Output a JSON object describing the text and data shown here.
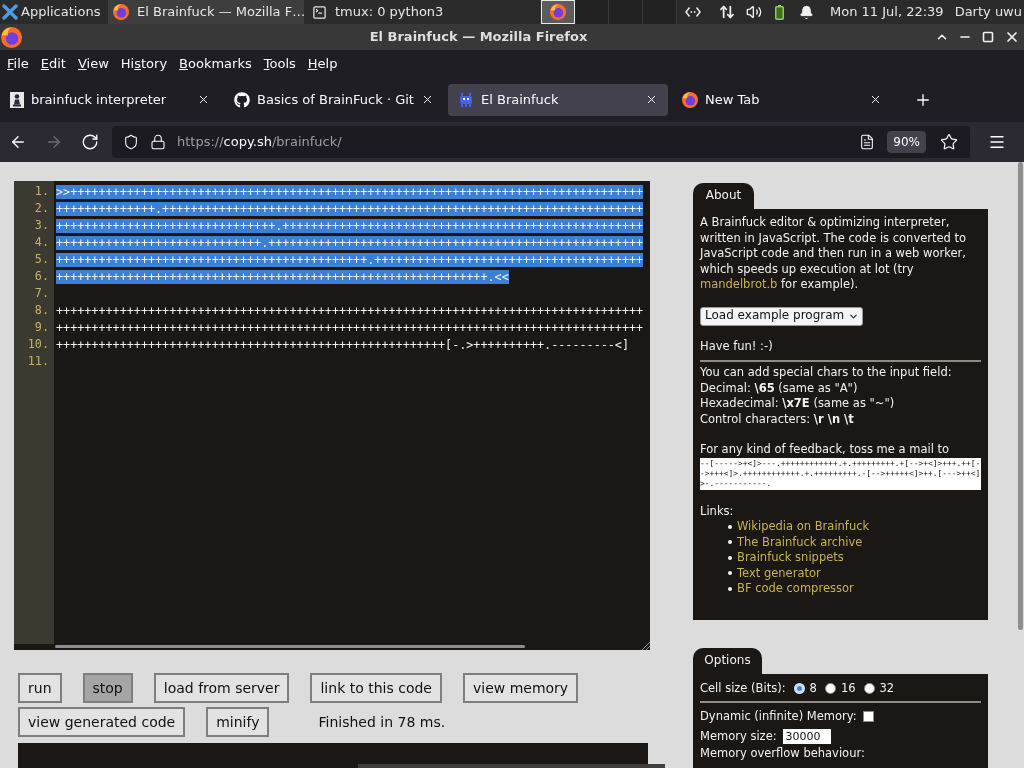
{
  "taskbar": {
    "apps_menu": "Applications",
    "windows": [
      {
        "kind": "browser",
        "title": "El Brainfuck — Mozilla F…",
        "selected": true
      },
      {
        "kind": "terminal",
        "title": "tmux: 0 python3",
        "selected": false
      }
    ],
    "workspaces": [
      {
        "kind": "browser",
        "selected": true
      },
      {
        "kind": "empty",
        "selected": false
      },
      {
        "kind": "empty",
        "selected": false
      },
      {
        "kind": "empty",
        "selected": false
      }
    ],
    "clock": "Mon 11 Jul, 22:39",
    "user": "Darty uwu"
  },
  "window": {
    "title": "El Brainfuck — Mozilla Firefox"
  },
  "menu": [
    {
      "key": "F",
      "after": "ile"
    },
    {
      "key": "E",
      "after": "dit"
    },
    {
      "key": "V",
      "after": "iew"
    },
    {
      "before": "Hi",
      "key": "s",
      "after": "tory"
    },
    {
      "key": "B",
      "after": "ookmarks"
    },
    {
      "key": "T",
      "after": "ools"
    },
    {
      "key": "H",
      "after": "elp"
    }
  ],
  "tabs": [
    {
      "kind": "pawn",
      "title": "brainfuck interpreter",
      "selected": false
    },
    {
      "kind": "github",
      "title": "Basics of BrainFuck · Git",
      "selected": false
    },
    {
      "kind": "invader",
      "title": "El Brainfuck",
      "selected": true
    },
    {
      "kind": "browser",
      "title": "New Tab",
      "selected": false
    }
  ],
  "toolbar": {
    "nav_buttons": [
      {
        "kind": "back",
        "disabled": false
      },
      {
        "kind": "forward",
        "disabled": true
      },
      {
        "kind": "reload",
        "disabled": false
      }
    ],
    "url": {
      "scheme": "https://",
      "host": "copy.sh",
      "path": "/brainfuck/"
    },
    "zoom": "90%"
  },
  "editor": {
    "lines": [
      {
        "number": "1.",
        "code": ">>+++++++++++++++++++++++++++++++++++++++++++++++++++++++++++++++++++++++++++++++++",
        "selected": true
      },
      {
        "number": "2.",
        "code": "++++++++++++++.++++++++++++++++++++++++++++++++++++++++++++++++++++++++++++++++++++",
        "selected": true
      },
      {
        "number": "3.",
        "code": "+++++++++++++++++++++++++++++++.+++++++++++++++++++++++++++++++++++++++++++++++++++",
        "selected": true
      },
      {
        "number": "4.",
        "code": "+++++++++++++++++++++++++++++.+++++++++++++++++++++++++++++++++++++++++++++++++++++",
        "selected": true
      },
      {
        "number": "5.",
        "code": "++++++++++++++++++++++++++++++++++++++++++++.++++++++++++++++++++++++++++++++++++++",
        "selected": true
      },
      {
        "number": "6.",
        "code": "+++++++++++++++++++++++++++++++++++++++++++++++++++++++++++++.<<",
        "selected": true
      },
      {
        "number": "7."
      },
      {
        "number": "8.",
        "code": "+++++++++++++++++++++++++++++++++++++++++++++++++++++++++++++++++++++++++++++++++++",
        "selected": false
      },
      {
        "number": "9.",
        "code": "+++++++++++++++++++++++++++++++++++++++++++++++++++++++++++++++++++++++++++++++++++",
        "selected": false
      },
      {
        "number": "10.",
        "code": "+++++++++++++++++++++++++++++++++++++++++++++++++++++++[-.>++++++++++.---------<]",
        "selected": false
      },
      {
        "number": "11."
      }
    ]
  },
  "buttons": [
    {
      "label": "run",
      "disabled": false
    },
    {
      "label": "stop",
      "disabled": true
    },
    {
      "label": "load from server",
      "disabled": false
    },
    {
      "label": "link to this code",
      "disabled": false
    },
    {
      "label": "view memory",
      "disabled": false
    },
    {
      "label": "view generated code",
      "disabled": false
    },
    {
      "label": "minify",
      "disabled": false
    }
  ],
  "status": "Finished in 78 ms.",
  "about": {
    "tab": "About",
    "intro": {
      "before": "A Brainfuck editor & optimizing interpreter, written in JavaScript. The code is converted to JavaScript code and then run in a web worker, which speeds up execution at lot (try ",
      "link": "mandelbrot.b",
      "after": " for example)."
    },
    "example_select": "Load example program",
    "have_fun": "Have fun! :-)",
    "special_intro": "You can add special chars to the input field:",
    "special_lines": [
      "Decimal: **\\65** (same as \"A\")",
      "Hexadecimal: **\\x7E** (same as \"~\")",
      "Control characters: **\\r \\n \\t**"
    ],
    "feedback": "For any kind of feedback, toss me a mail to",
    "mail_code": "--[----->+<]>---.++++++++++++.+.+++++++++.+[-->+<]>+++.++[-->+++<]>.++++++++++++.+.+++++++++.-[-->+++++<]>++.[--->++<]>-.-----------.",
    "links_label": "Links:",
    "links": [
      "Wikipedia on Brainfuck",
      "The Brainfuck archive",
      "Brainfuck snippets",
      "Text generator",
      "BF code compressor"
    ]
  },
  "options": {
    "tab": "Options",
    "cell_size": {
      "label": "Cell size (Bits):",
      "options": [
        {
          "label": "8",
          "selected": true
        },
        {
          "label": "16",
          "selected": false
        },
        {
          "label": "32",
          "selected": false
        }
      ]
    },
    "dynamic_memory": {
      "label": "Dynamic (infinite) Memory:",
      "checked": false
    },
    "memory_size": {
      "label": "Memory size:",
      "value": "30000"
    },
    "overflow_label": "Memory overflow behaviour:"
  }
}
